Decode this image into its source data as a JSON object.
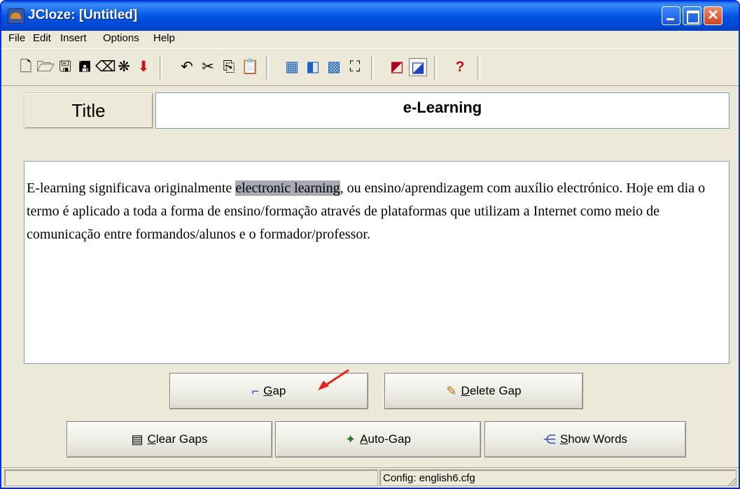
{
  "window": {
    "title": "JCloze: [Untitled]",
    "controls": {
      "minimize": "minimize",
      "maximize": "maximize",
      "close": "✕"
    }
  },
  "menu": [
    "File",
    "Edit",
    "Insert",
    "Options",
    "Help"
  ],
  "toolbar": {
    "icons": [
      "new-file-icon",
      "open-folder-icon",
      "save-icon",
      "save-as-icon",
      "eraser-icon",
      "web-export-icon",
      "insert-arrow-icon",
      "undo-icon",
      "cut-icon",
      "copy-icon",
      "paste-icon",
      "create-web-page-icon",
      "create-drag-drop-icon",
      "export-icon",
      "jump-icon",
      "config-icon",
      "pressed-toggle-icon",
      "help-icon"
    ]
  },
  "title_label": "Title",
  "title_value": "e-Learning",
  "text": {
    "before": "E-learning significava originalmente ",
    "highlight": "electronic learning",
    "after": ", ou ensino/aprendizagem com auxílio electrónico. Hoje em dia o termo é aplicado a toda a forma de ensino/formação através de plataformas que utilizam a Internet como meio de comunicação entre formandos/alunos e o formador/professor."
  },
  "buttons": {
    "gap": {
      "mnemonic": "G",
      "rest": "ap",
      "icon": "gap-icon"
    },
    "delete_gap": {
      "mnemonic": "D",
      "rest": "elete Gap",
      "icon": "delete-gap-icon"
    },
    "clear_gaps": {
      "mnemonic": "C",
      "rest": "lear Gaps",
      "icon": "clear-gaps-icon"
    },
    "auto_gap": {
      "mnemonic": "A",
      "rest": "uto-Gap",
      "icon": "auto-gap-icon"
    },
    "show_words": {
      "mnemonic": "S",
      "rest": "how Words",
      "icon": "show-words-icon"
    }
  },
  "status": {
    "config": "Config: english6.cfg"
  },
  "colors": {
    "titlebar": "#0054e3",
    "highlight": "#a7a9b3",
    "annotation_arrow": "#e8221a"
  }
}
